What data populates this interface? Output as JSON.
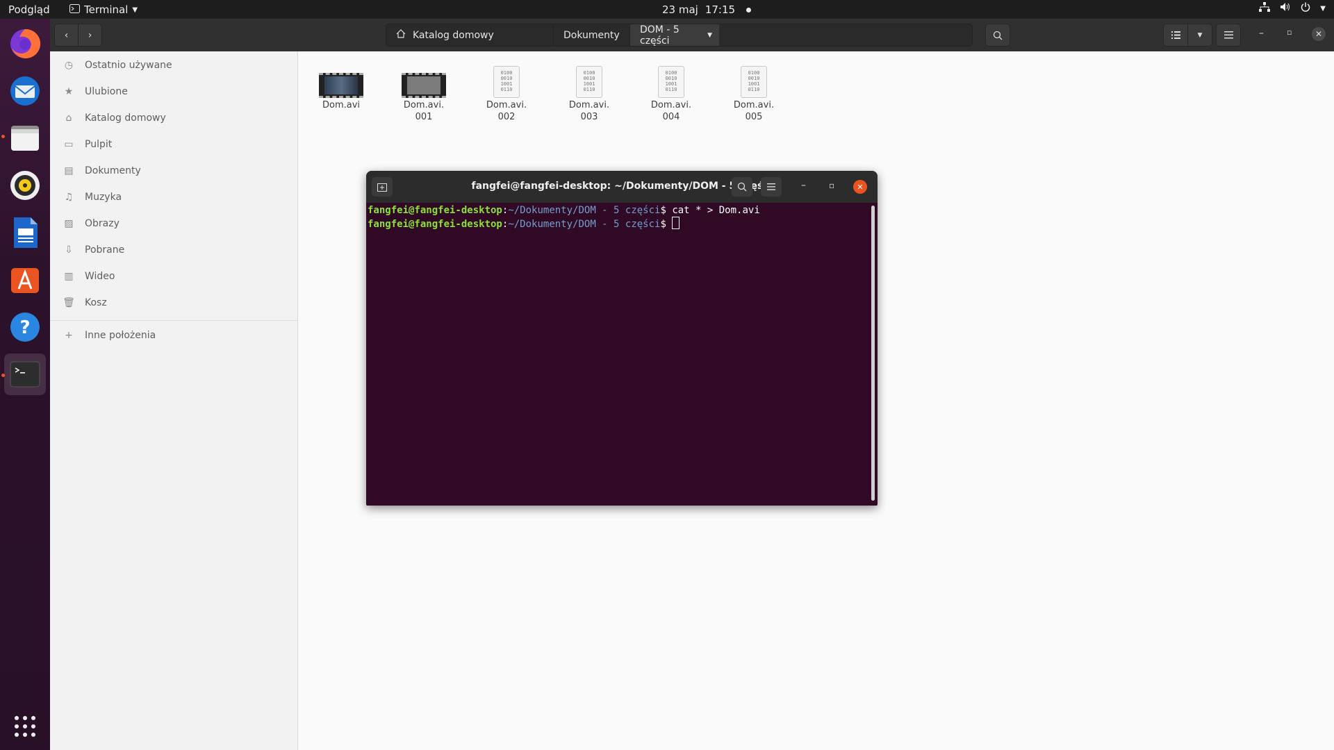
{
  "topbar": {
    "activities": "Podgląd",
    "app_name": "Terminal",
    "date": "23 maj",
    "time": "17:15"
  },
  "dock": {
    "items": [
      {
        "name": "firefox",
        "active": false,
        "running": false
      },
      {
        "name": "thunderbird",
        "active": false,
        "running": false
      },
      {
        "name": "files",
        "active": false,
        "running": true
      },
      {
        "name": "rhythmbox",
        "active": false,
        "running": false
      },
      {
        "name": "libreoffice-writer",
        "active": false,
        "running": false
      },
      {
        "name": "ubuntu-software",
        "active": false,
        "running": false
      },
      {
        "name": "help",
        "active": false,
        "running": false
      },
      {
        "name": "terminal",
        "active": true,
        "running": true
      }
    ]
  },
  "filemanager": {
    "breadcrumbs": [
      "Katalog domowy",
      "Dokumenty",
      "DOM - 5 części"
    ],
    "sidebar": [
      {
        "label": "Ostatnio używane",
        "icon": "clock-icon"
      },
      {
        "label": "Ulubione",
        "icon": "star-icon"
      },
      {
        "label": "Katalog domowy",
        "icon": "home-icon"
      },
      {
        "label": "Pulpit",
        "icon": "desktop-icon"
      },
      {
        "label": "Dokumenty",
        "icon": "document-icon"
      },
      {
        "label": "Muzyka",
        "icon": "music-icon"
      },
      {
        "label": "Obrazy",
        "icon": "image-icon"
      },
      {
        "label": "Pobrane",
        "icon": "download-icon"
      },
      {
        "label": "Wideo",
        "icon": "video-icon"
      },
      {
        "label": "Kosz",
        "icon": "trash-icon"
      }
    ],
    "other_locations": "Inne położenia",
    "files": [
      {
        "name_line1": "Dom.avi",
        "name_line2": "",
        "type": "video"
      },
      {
        "name_line1": "Dom.avi.",
        "name_line2": "001",
        "type": "video"
      },
      {
        "name_line1": "Dom.avi.",
        "name_line2": "002",
        "type": "binary"
      },
      {
        "name_line1": "Dom.avi.",
        "name_line2": "003",
        "type": "binary"
      },
      {
        "name_line1": "Dom.avi.",
        "name_line2": "004",
        "type": "binary"
      },
      {
        "name_line1": "Dom.avi.",
        "name_line2": "005",
        "type": "binary"
      }
    ],
    "binary_glyph": [
      "0100",
      "0010",
      "1001",
      "0110"
    ]
  },
  "terminal": {
    "title": "fangfei@fangfei-desktop: ~/Dokumenty/DOM - 5 części",
    "lines": [
      {
        "user": "fangfei@fangfei-desktop",
        "sep": ":",
        "path": "~/Dokumenty/DOM - 5 części",
        "prompt": "$ ",
        "command": "cat * > Dom.avi"
      },
      {
        "user": "fangfei@fangfei-desktop",
        "sep": ":",
        "path": "~/Dokumenty/DOM - 5 części",
        "prompt": "$ ",
        "command": ""
      }
    ]
  },
  "colors": {
    "terminal_bg": "#300a24",
    "prompt_user": "#8ae234",
    "prompt_path": "#729fcf",
    "accent": "#e95420"
  }
}
